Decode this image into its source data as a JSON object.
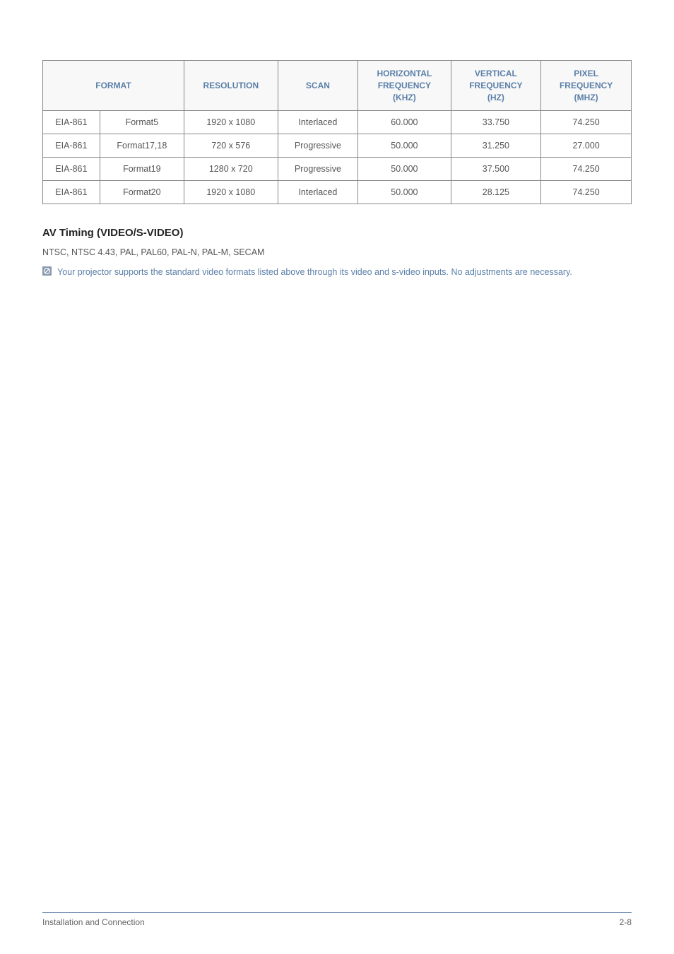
{
  "chart_data": {
    "type": "table",
    "title": "",
    "columns": [
      "FORMAT (col1)",
      "FORMAT (col2)",
      "RESOLUTION",
      "SCAN",
      "HORIZONTAL FREQUENCY (KHZ)",
      "VERTICAL FREQUENCY (HZ)",
      "PIXEL FREQUENCY (MHZ)"
    ],
    "rows": [
      [
        "EIA-861",
        "Format5",
        "1920 x 1080",
        "Interlaced",
        "60.000",
        "33.750",
        "74.250"
      ],
      [
        "EIA-861",
        "Format17,18",
        "720 x 576",
        "Progressive",
        "50.000",
        "31.250",
        "27.000"
      ],
      [
        "EIA-861",
        "Format19",
        "1280 x 720",
        "Progressive",
        "50.000",
        "37.500",
        "74.250"
      ],
      [
        "EIA-861",
        "Format20",
        "1920 x 1080",
        "Interlaced",
        "50.000",
        "28.125",
        "74.250"
      ]
    ]
  },
  "table": {
    "headers": {
      "format": "FORMAT",
      "resolution": "RESOLUTION",
      "scan": "SCAN",
      "hfreq_l1": "HORIZONTAL",
      "hfreq_l2": "FREQUENCY",
      "hfreq_l3": "(KHZ)",
      "vfreq_l1": "VERTICAL",
      "vfreq_l2": "FREQUENCY",
      "vfreq_l3": "(HZ)",
      "pfreq_l1": "PIXEL",
      "pfreq_l2": "FREQUENCY",
      "pfreq_l3": "(MHZ)"
    },
    "rows": [
      {
        "c0": "EIA-861",
        "c1": "Format5",
        "c2": "1920 x 1080",
        "c3": "Interlaced",
        "c4": "60.000",
        "c5": "33.750",
        "c6": "74.250"
      },
      {
        "c0": "EIA-861",
        "c1": "Format17,18",
        "c2": "720 x 576",
        "c3": "Progressive",
        "c4": "50.000",
        "c5": "31.250",
        "c6": "27.000"
      },
      {
        "c0": "EIA-861",
        "c1": "Format19",
        "c2": "1280 x 720",
        "c3": "Progressive",
        "c4": "50.000",
        "c5": "37.500",
        "c6": "74.250"
      },
      {
        "c0": "EIA-861",
        "c1": "Format20",
        "c2": "1920 x 1080",
        "c3": "Interlaced",
        "c4": "50.000",
        "c5": "28.125",
        "c6": "74.250"
      }
    ]
  },
  "sections": {
    "av_timing_heading": "AV Timing (VIDEO/S-VIDEO)",
    "av_timing_body": "NTSC, NTSC 4.43, PAL, PAL60, PAL-N, PAL-M, SECAM",
    "note_text": "Your projector supports the standard video formats listed above through its video and s-video inputs. No adjustments are necessary."
  },
  "footer": {
    "left": "Installation and Connection",
    "right": "2-8"
  }
}
